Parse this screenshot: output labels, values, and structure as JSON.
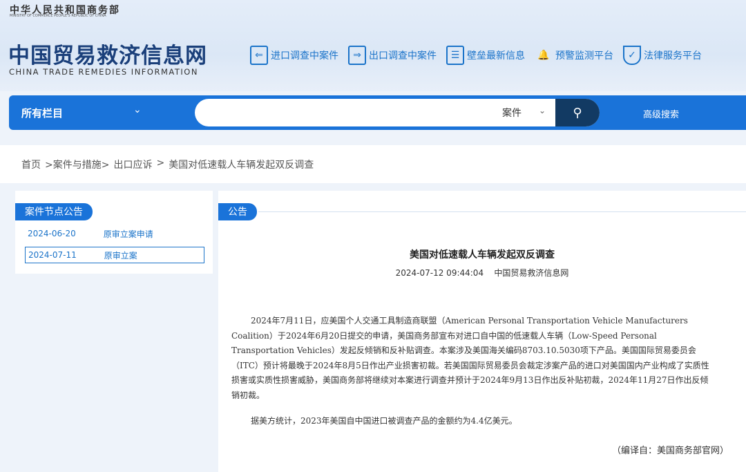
{
  "header": {
    "ministry_cn": "中华人民共和国商务部",
    "ministry_en": "MINISTRY OF COMMERCE PEOPLE'S REPUBLIC OF CHINA",
    "site_title": "中国贸易救济信息网",
    "site_title_en": "CHINA TRADE REMEDIES INFORMATION",
    "nav": [
      {
        "label": "进口调查中案件",
        "icon": "import-clipboard-icon",
        "glyph": "⇐"
      },
      {
        "label": "出口调查中案件",
        "icon": "export-clipboard-icon",
        "glyph": "⇒"
      },
      {
        "label": "壁垒最新信息",
        "icon": "news-icon",
        "glyph": "☰"
      },
      {
        "label": "预警监测平台",
        "icon": "bell-icon",
        "glyph": "🔔"
      },
      {
        "label": "法律服务平台",
        "icon": "shield-icon",
        "glyph": "✓"
      }
    ]
  },
  "search": {
    "category": "所有栏目",
    "scope": "案件",
    "placeholder": "",
    "advanced": "高级搜索"
  },
  "breadcrumb": [
    "首页",
    ">案件与措施>",
    "出口应诉",
    ">",
    "美国对低速载人车辆发起双反调查"
  ],
  "sidebar": {
    "title": "案件节点公告",
    "items": [
      {
        "date": "2024-06-20",
        "label": "原审立案申请"
      },
      {
        "date": "2024-07-11",
        "label": "原审立案"
      }
    ]
  },
  "article": {
    "section": "公告",
    "title": "美国对低速载人车辆发起双反调查",
    "datetime": "2024-07-12 09:44:04",
    "source": "中国贸易救济信息网",
    "paragraphs": [
      "2024年7月11日，应美国个人交通工具制造商联盟（American Personal Transportation Vehicle Manufacturers Coalition）于2024年6月20日提交的申请，美国商务部宣布对进口自中国的低速载人车辆（Low-Speed Personal Transportation Vehicles）发起反倾销和反补贴调查。本案涉及美国海关编码8703.10.5030项下产品。美国国际贸易委员会（ITC）预计将最晚于2024年8月5日作出产业损害初裁。若美国国际贸易委员会裁定涉案产品的进口对美国国内产业构成了实质性损害或实质性损害威胁，美国商务部将继续对本案进行调查并预计于2024年9月13日作出反补贴初裁，2024年11月27日作出反倾销初裁。",
      "据美方统计，2023年美国自中国进口被调查产品的金额约为4.4亿美元。"
    ],
    "compiled_from": "（编译自：美国商务部官网）"
  }
}
